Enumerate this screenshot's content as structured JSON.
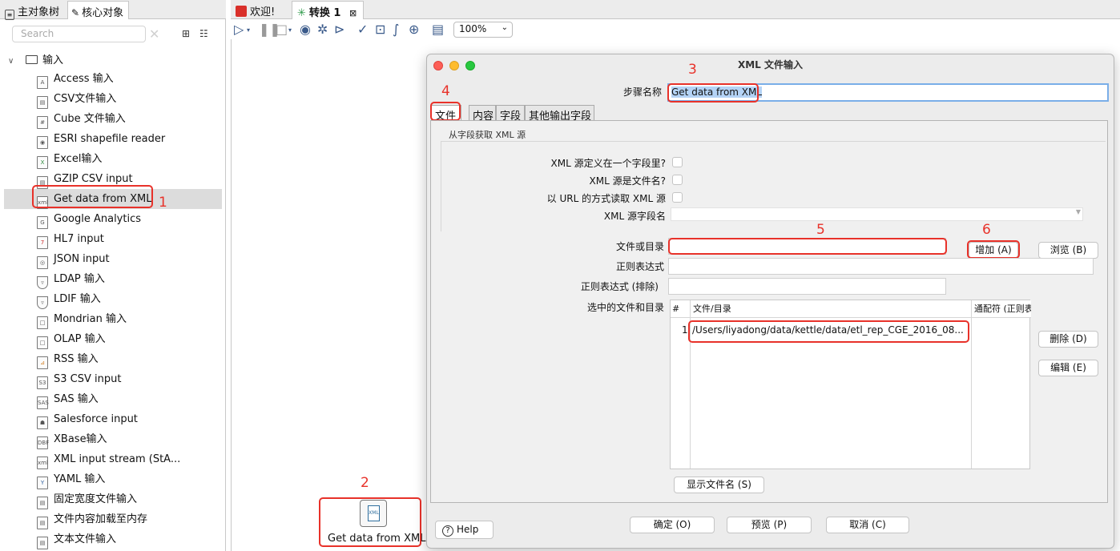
{
  "left_panel": {
    "tabs": [
      {
        "label": "主对象树",
        "icon": "tree-icon"
      },
      {
        "label": "核心对象",
        "icon": "pencil-icon"
      }
    ],
    "search_placeholder": "Search",
    "tree": {
      "root_label": "输入",
      "items": [
        {
          "label": "Access 输入",
          "icon": "A"
        },
        {
          "label": "CSV文件输入",
          "icon": "csv"
        },
        {
          "label": "Cube 文件输入",
          "icon": "#"
        },
        {
          "label": "ESRI shapefile reader",
          "icon": "map"
        },
        {
          "label": "Excel输入",
          "icon": "X"
        },
        {
          "label": "GZIP CSV input",
          "icon": "gz"
        },
        {
          "label": "Get data from XML",
          "icon": "xml"
        },
        {
          "label": "Google Analytics",
          "icon": "G"
        },
        {
          "label": "HL7 input",
          "icon": "7"
        },
        {
          "label": "JSON input",
          "icon": "js"
        },
        {
          "label": "LDAP 输入",
          "icon": "ldap"
        },
        {
          "label": "LDIF 输入",
          "icon": "ldif"
        },
        {
          "label": "Mondrian 输入",
          "icon": "cube"
        },
        {
          "label": "OLAP 输入",
          "icon": "cube"
        },
        {
          "label": "RSS 输入",
          "icon": "rss"
        },
        {
          "label": "S3 CSV input",
          "icon": "S3"
        },
        {
          "label": "SAS 输入",
          "icon": "SAS"
        },
        {
          "label": "Salesforce input",
          "icon": "sf"
        },
        {
          "label": "XBase输入",
          "icon": "DBF"
        },
        {
          "label": "XML input stream (StA...",
          "icon": "xml"
        },
        {
          "label": "YAML 输入",
          "icon": "Y"
        },
        {
          "label": "固定宽度文件输入",
          "icon": "txt"
        },
        {
          "label": "文件内容加载至内存",
          "icon": "txt"
        },
        {
          "label": "文本文件输入",
          "icon": "txt"
        }
      ]
    }
  },
  "editor_tabs": [
    {
      "label": "欢迎!",
      "color": "#d9302a"
    },
    {
      "label": "转换 1",
      "color": "#2e9a4a",
      "close": "⊠"
    }
  ],
  "toolbar": {
    "zoom": "100%"
  },
  "canvas": {
    "step_label": "Get data from XML",
    "step_icon_text": "XML"
  },
  "annotations": [
    "1",
    "2",
    "3",
    "4",
    "5",
    "6"
  ],
  "dialog": {
    "title": "XML 文件输入",
    "step_name_label": "步骤名称",
    "step_name_value": "Get data from XML",
    "tabs": [
      "文件",
      "内容",
      "字段",
      "其他输出字段"
    ],
    "group_title": "从字段获取 XML 源",
    "xml_in_field_label": "XML 源定义在一个字段里?",
    "xml_is_filename_label": "XML 源是文件名?",
    "read_url_label": "以 URL 的方式读取 XML 源",
    "xml_field_name_label": "XML 源字段名",
    "file_or_dir_label": "文件或目录",
    "add_button": "增加 (A)",
    "browse_button": "浏览 (B)",
    "regex_label": "正则表达式",
    "regex_exclude_label": "正则表达式 (排除)",
    "selected_files_label": "选中的文件和目录",
    "table": {
      "columns": [
        "#",
        "文件/目录",
        "通配符 (正则表"
      ],
      "rows": [
        {
          "num": "1",
          "path": "/Users/liyadong/data/kettle/data/etl_rep_CGE_2016_08..."
        }
      ]
    },
    "delete_button": "删除 (D)",
    "edit_button": "编辑 (E)",
    "show_filenames_button": "显示文件名 (S)",
    "help_button": "Help",
    "ok_button": "确定 (O)",
    "preview_button": "预览 (P)",
    "cancel_button": "取消 (C)"
  }
}
